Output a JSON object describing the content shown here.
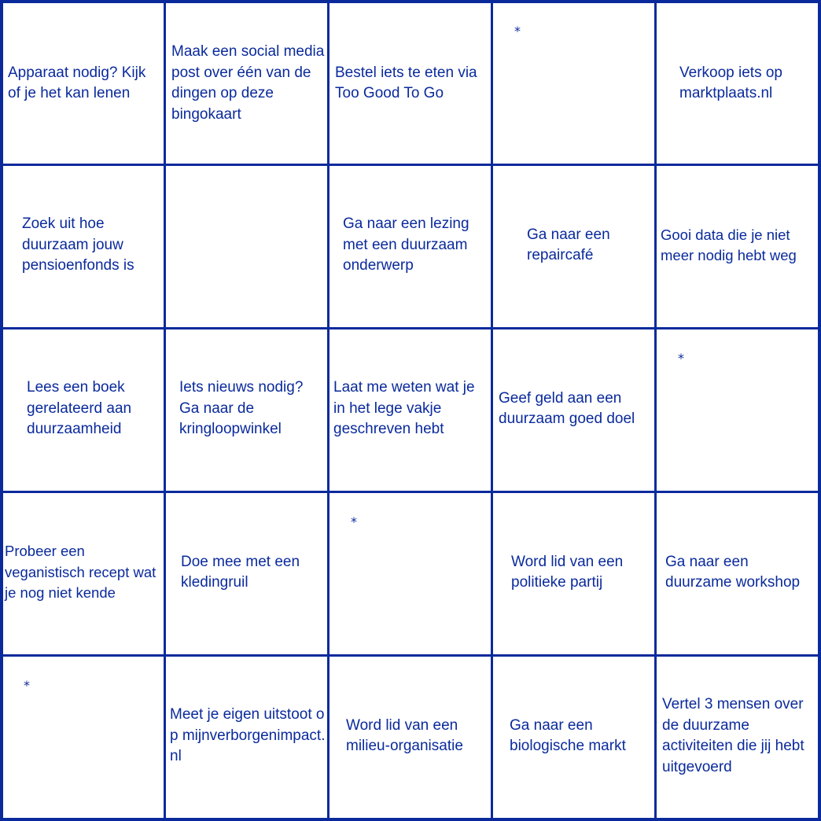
{
  "board": {
    "rows": [
      [
        "Apparaat nodig? Kijk of je het kan lenen",
        "Maak een social media post over één van de dingen op deze bingokaart",
        "Bestel iets te eten via Too Good To Go",
        "*",
        "Verkoop iets op marktplaats.nl"
      ],
      [
        "Zoek uit hoe duurzaam jouw pensioenfonds is",
        "",
        "Ga naar een lezing met een duurzaam onderwerp",
        "Ga naar een repaircafé",
        "Gooi data die je niet meer nodig hebt weg"
      ],
      [
        "Lees een boek gerelateerd aan duurzaamheid",
        "Iets nieuws nodig? Ga naar de kringloopwinkel",
        "Laat me weten wat je in het lege vakje geschreven hebt",
        "Geef geld aan een duurzaam goed doel",
        "*"
      ],
      [
        "Probeer een veganistisch recept wat je nog niet kende",
        "Doe mee met een kledingruil",
        "*",
        "Word lid van een politieke partij",
        "Ga naar een duurzame workshop"
      ],
      [
        "*",
        "Meet je eigen uitstoot op mijnverborgenimpact.nl",
        "Word lid van een milieu-organisatie",
        "Ga naar een biologische markt",
        "Vertel 3 mensen over de duurzame activiteiten die jij hebt uitgevoerd"
      ]
    ]
  },
  "colors": {
    "ink": "#0a2a9c",
    "background": "#ffffff"
  }
}
